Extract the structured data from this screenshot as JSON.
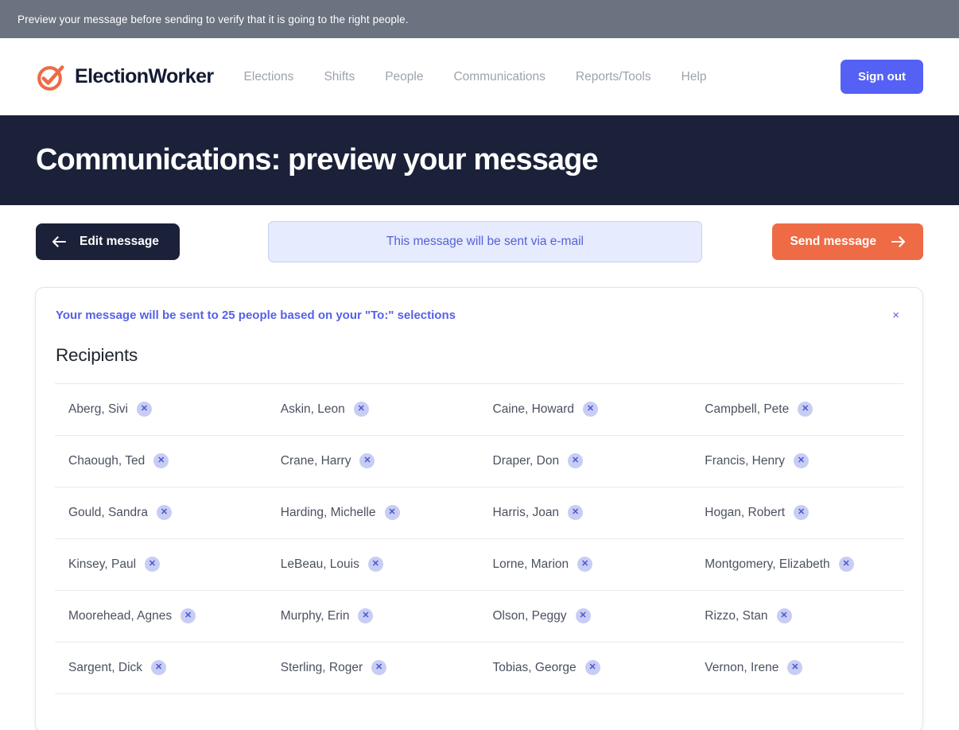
{
  "notice": {
    "text": "Preview your message before sending to verify that it is going to the right people."
  },
  "navbar": {
    "brand_name": "ElectionWorker",
    "logo_icon": "check-circle-logo-icon",
    "links": [
      {
        "label": "Elections"
      },
      {
        "label": "Shifts"
      },
      {
        "label": "People"
      },
      {
        "label": "Communications"
      },
      {
        "label": "Reports/Tools"
      },
      {
        "label": "Help"
      }
    ],
    "signout_label": "Sign out"
  },
  "hero": {
    "title": "Communications: preview your message"
  },
  "actions": {
    "edit_label": "Edit message",
    "edit_icon": "arrow-left-icon",
    "channel_note": "This message will be sent via e-mail",
    "send_label": "Send message",
    "send_icon": "arrow-right-icon"
  },
  "card": {
    "alert_text": "Your message will be sent to 25 people based on your \"To:\" selections",
    "close_icon": "close-icon",
    "close_label": "×",
    "heading": "Recipients",
    "remove_glyph": "✕",
    "recipient_rows": [
      [
        {
          "name": "Aberg, Sivi"
        },
        {
          "name": "Askin, Leon"
        },
        {
          "name": "Caine, Howard"
        },
        {
          "name": "Campbell, Pete"
        }
      ],
      [
        {
          "name": "Chaough, Ted"
        },
        {
          "name": "Crane, Harry"
        },
        {
          "name": "Draper, Don"
        },
        {
          "name": "Francis, Henry"
        }
      ],
      [
        {
          "name": "Gould, Sandra"
        },
        {
          "name": "Harding, Michelle"
        },
        {
          "name": "Harris, Joan"
        },
        {
          "name": "Hogan, Robert"
        }
      ],
      [
        {
          "name": "Kinsey, Paul"
        },
        {
          "name": "LeBeau, Louis"
        },
        {
          "name": "Lorne, Marion"
        },
        {
          "name": "Montgomery, Elizabeth"
        }
      ],
      [
        {
          "name": "Moorehead, Agnes"
        },
        {
          "name": "Murphy, Erin"
        },
        {
          "name": "Olson, Peggy"
        },
        {
          "name": "Rizzo, Stan"
        }
      ],
      [
        {
          "name": "Sargent, Dick"
        },
        {
          "name": "Sterling, Roger"
        },
        {
          "name": "Tobias, George"
        },
        {
          "name": "Vernon, Irene"
        }
      ]
    ]
  },
  "colors": {
    "notice_bar": "#6b7280",
    "hero_navy": "#1b2139",
    "brand_orange": "#ee6b45",
    "accent_indigo": "#5561f5",
    "note_bg": "#e6ebfd",
    "chip_bg": "#c8cdf4"
  }
}
